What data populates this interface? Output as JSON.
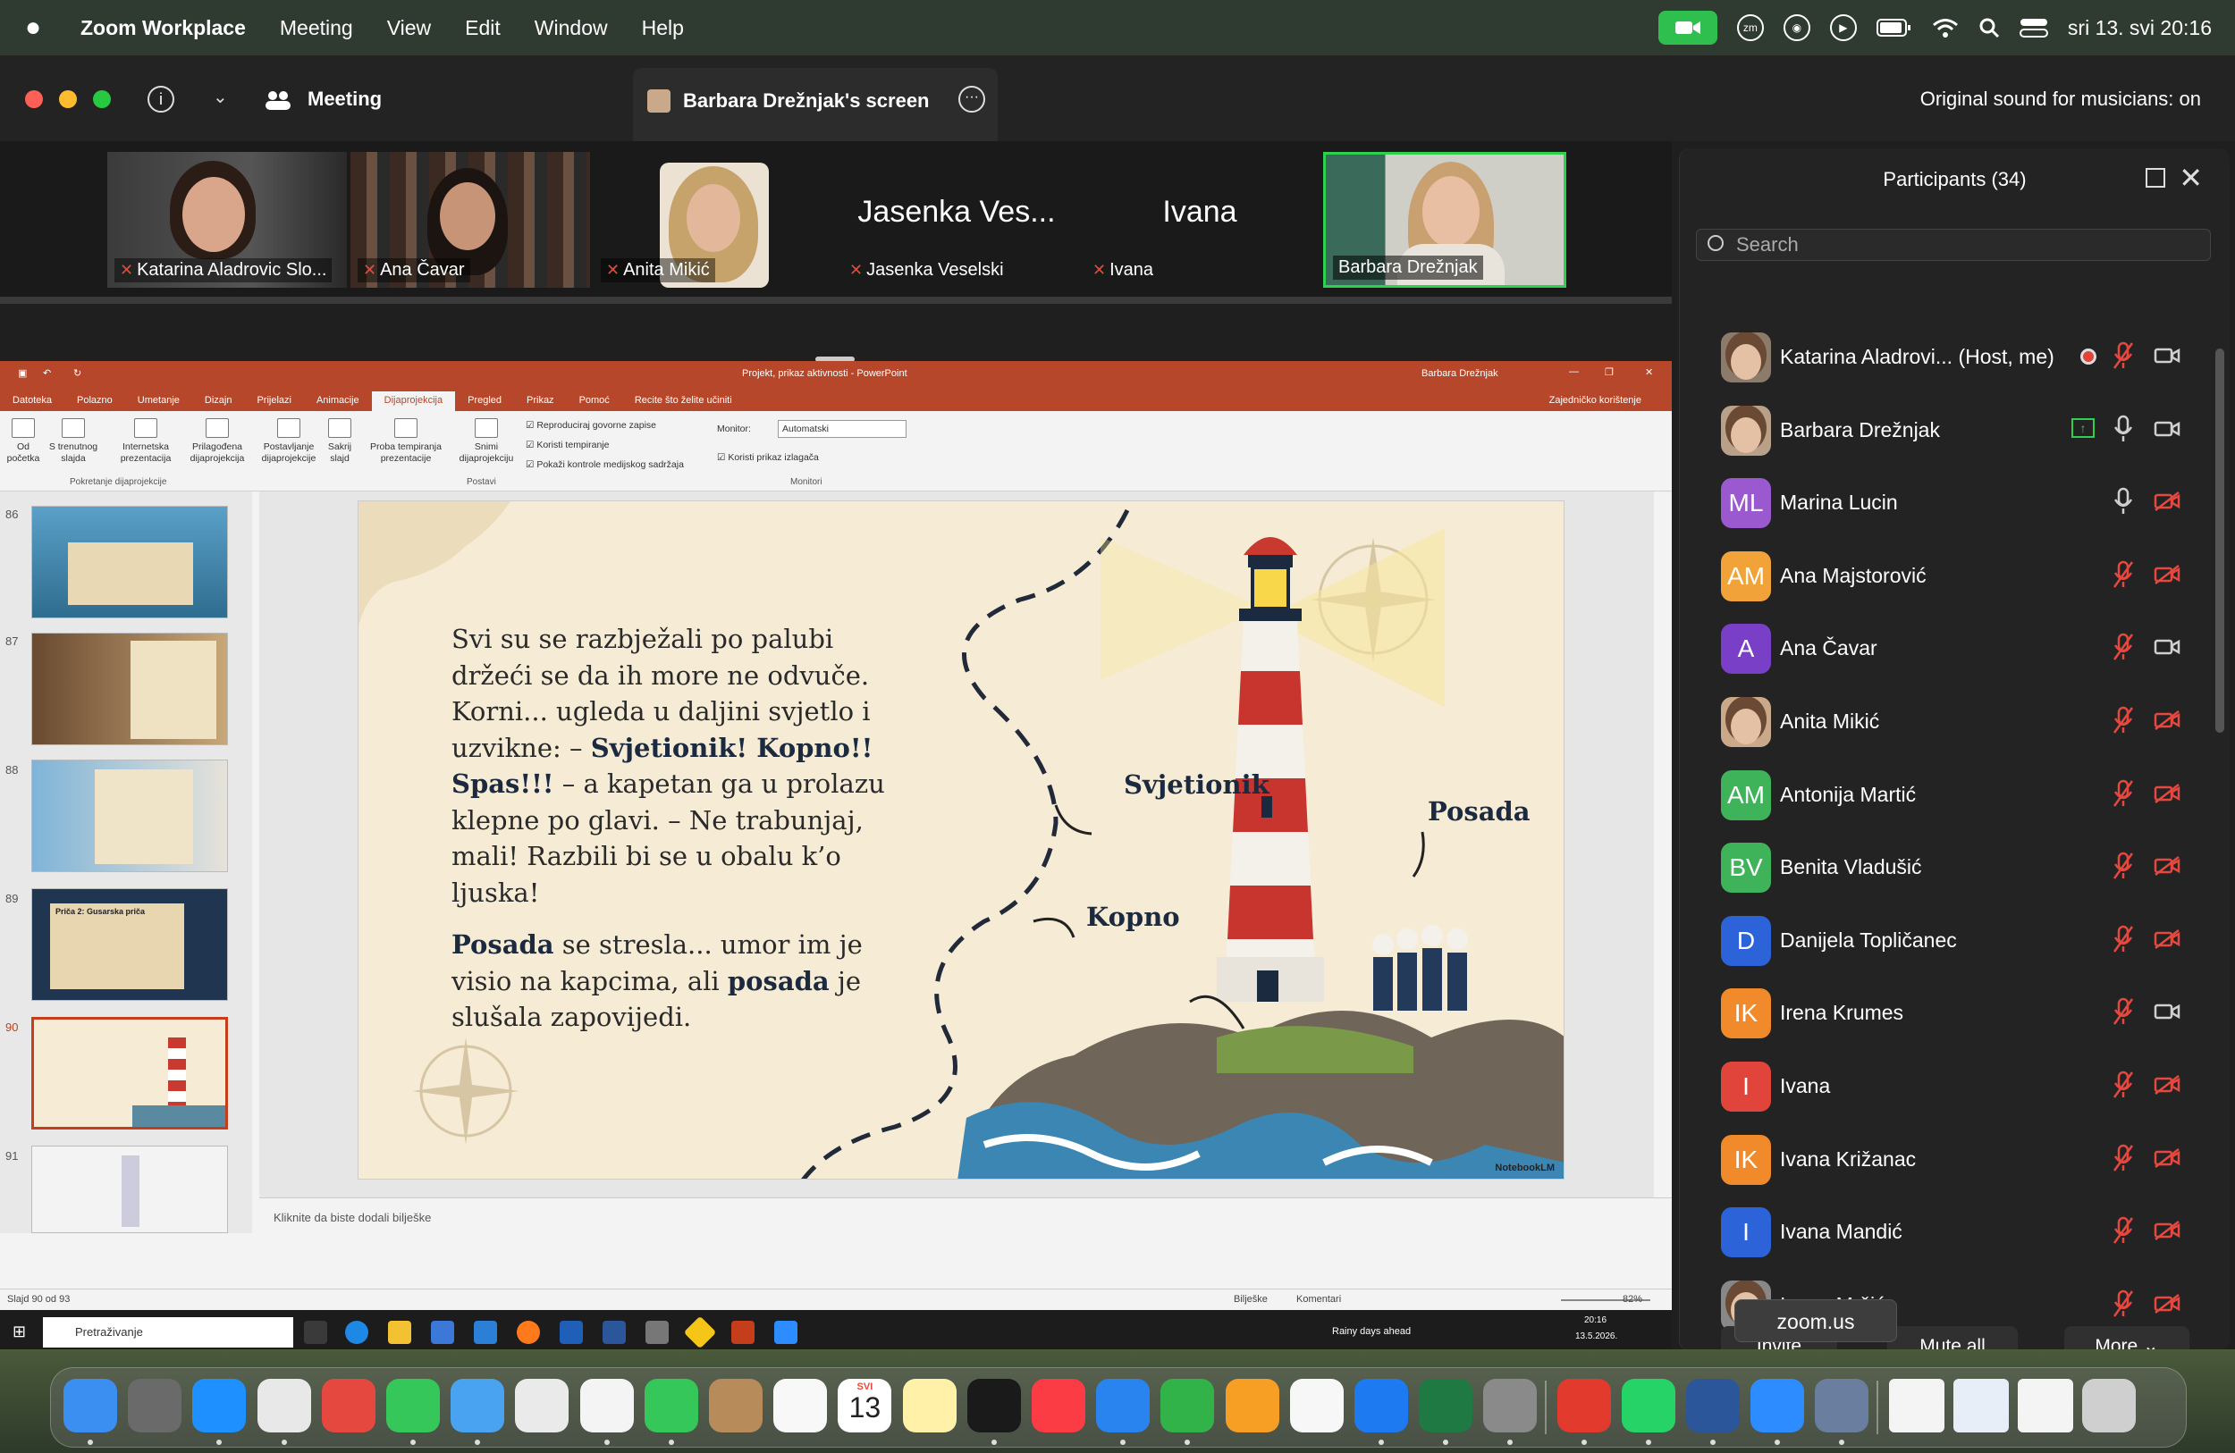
{
  "menubar": {
    "app": "Zoom Workplace",
    "items": [
      "Meeting",
      "View",
      "Edit",
      "Window",
      "Help"
    ],
    "datetime": "sri 13. svi  20:16"
  },
  "titlebar": {
    "meeting_label": "Meeting",
    "share_tab": "Barbara Drežnjak's screen",
    "sound": "Original sound for musicians: on"
  },
  "videos": [
    {
      "name": "Katarina Aladrovic Slo...",
      "muted": true
    },
    {
      "name": "Ana Čavar",
      "muted": true
    },
    {
      "name": "Anita Mikić",
      "muted": true
    },
    {
      "name": "Jasenka Veselski",
      "big": "Jasenka Ves...",
      "muted": true
    },
    {
      "name": "Ivana",
      "big": "Ivana",
      "muted": true
    },
    {
      "name": "Barbara Drežnjak",
      "muted": false
    }
  ],
  "ppt": {
    "doc_title": "Projekt, prikaz aktivnosti  -  PowerPoint",
    "user": "Barbara Drežnjak",
    "tabs": [
      "Datoteka",
      "Polazno",
      "Umetanje",
      "Dizajn",
      "Prijelazi",
      "Animacije",
      "Dijaprojekcija",
      "Pregled",
      "Prikaz",
      "Pomoć",
      "Recite što želite učiniti"
    ],
    "share_label": "Zajedničko korištenje",
    "ribbon": {
      "b1": "Od početka",
      "b2": "S trenutnog slajda",
      "b3": "Internetska prezentacija",
      "b4": "Prilagođena dijaprojekcija",
      "b5": "Postavljanje dijaprojekcije",
      "b6": "Sakrij slajd",
      "b7": "Proba tempiranja prezentacije",
      "b8": "Snimi dijaprojekciju",
      "c1": "Reproduciraj govorne zapise",
      "c2": "Koristi tempiranje",
      "c3": "Pokaži kontrole medijskog sadržaja",
      "monitor_label": "Monitor:",
      "monitor_value": "Automatski",
      "c4": "Koristi prikaz izlagača",
      "g1": "Pokretanje dijaprojekcije",
      "g2": "Postavi",
      "g3": "Monitori"
    },
    "thumb_numbers": [
      "86",
      "87",
      "88",
      "89",
      "90",
      "91"
    ],
    "thumb89_title": "Priča 2: Gusarska priča",
    "slide": {
      "p1": [
        "Svi su se razbježali po palubi",
        "držeći se da ih more ne odvuče.",
        "Korni... ugleda u daljini svjetlo i",
        "uzvikne: – "
      ],
      "p1_bold": "Svjetionik! Kopno!! Spas!!!",
      "p1_rest": " – a kapetan ga u prolazu klepne po glavi. – Ne trabunjaj, mali! Razbili bi se u obalu k’o ljuska!",
      "p2_bold1": "Posada",
      "p2_mid": " se stresla... umor im je visio na kapcima, ali ",
      "p2_bold2": "posada",
      "p2_end": " je slušala zapovijedi.",
      "label_lighthouse": "Svjetionik",
      "label_crew": "Posada",
      "label_land": "Kopno",
      "watermark": "NotebookLM"
    },
    "notes_placeholder": "Kliknite da biste dodali bilješke",
    "status_left": "Slajd 90 od 93",
    "status_notes": "Bilješke",
    "status_comments": "Komentari",
    "zoom": "82%",
    "taskbar_search": "Pretraživanje",
    "weather": "Rainy days ahead",
    "tb_time": "20:16",
    "tb_date": "13.5.2026."
  },
  "participants": {
    "title": "Participants (34)",
    "search_placeholder": "Search",
    "list": [
      {
        "name": "Katarina Aladrovi...  (Host, me)",
        "initials": "",
        "color": "#8c7a6a",
        "photo": true,
        "mic": "off",
        "cam": "on"
      },
      {
        "name": "Barbara Drežnjak",
        "initials": "",
        "color": "#b9a088",
        "photo": true,
        "mic": "on",
        "cam": "on"
      },
      {
        "name": "Marina Lucin",
        "initials": "ML",
        "color": "#9b59d0",
        "mic": "on",
        "cam": "off"
      },
      {
        "name": "Ana Majstorović",
        "initials": "AM",
        "color": "#f1a33a",
        "mic": "off",
        "cam": "off"
      },
      {
        "name": "Ana Čavar",
        "initials": "A",
        "color": "#7a3fc7",
        "mic": "off",
        "cam": "on"
      },
      {
        "name": "Anita Mikić",
        "initials": "",
        "color": "#c9a98a",
        "photo": true,
        "mic": "off",
        "cam": "off"
      },
      {
        "name": "Antonija Martić",
        "initials": "AM",
        "color": "#3fb35a",
        "mic": "off",
        "cam": "off"
      },
      {
        "name": "Benita Vladušić",
        "initials": "BV",
        "color": "#3fb35a",
        "mic": "off",
        "cam": "off"
      },
      {
        "name": "Danijela Topličanec",
        "initials": "D",
        "color": "#2d63d8",
        "mic": "off",
        "cam": "off"
      },
      {
        "name": "Irena Krumes",
        "initials": "IK",
        "color": "#f08a2a",
        "mic": "off",
        "cam": "on"
      },
      {
        "name": "Ivana",
        "initials": "I",
        "color": "#e0443a",
        "mic": "off",
        "cam": "off"
      },
      {
        "name": "Ivana Križanac",
        "initials": "IK",
        "color": "#f08a2a",
        "mic": "off",
        "cam": "off"
      },
      {
        "name": "Ivana Mandić",
        "initials": "I",
        "color": "#2d63d8",
        "mic": "off",
        "cam": "off"
      },
      {
        "name": "Ivana Mršić",
        "initials": "",
        "color": "#888",
        "photo": true,
        "mic": "off",
        "cam": "off"
      }
    ],
    "invite": "Invite",
    "mute_all": "Mute all",
    "more": "More"
  },
  "tooltip": "zoom.us",
  "dock": {
    "calendar_month": "SVI",
    "calendar_day": "13",
    "apps": [
      "Finder",
      "Launchpad",
      "Safari",
      "Chrome",
      "Zotero",
      "Messages",
      "Mail",
      "Maps",
      "Photos",
      "FaceTime",
      "Contacts",
      "Reminders",
      "Notes",
      "TV",
      "Music",
      "Keynote",
      "Numbers",
      "Pages",
      "Freeform",
      "App Store",
      "Excel",
      "Settings",
      "Acrobat",
      "WhatsApp",
      "Word",
      "Zoom",
      "Preview",
      "Trash"
    ]
  }
}
